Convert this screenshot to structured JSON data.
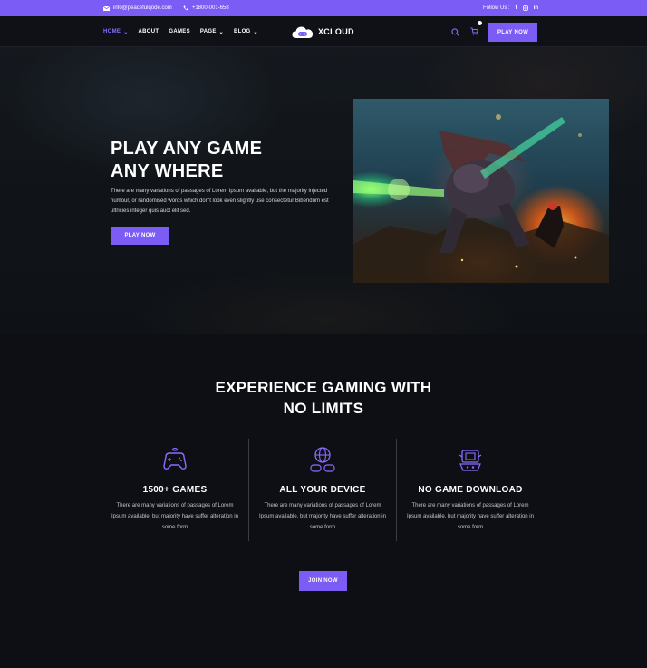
{
  "topbar": {
    "email": "info@peacefulqode.com",
    "phone": "+1800-001-658",
    "follow_label": "Follow Us :",
    "social": [
      "f",
      "ig",
      "in"
    ]
  },
  "nav": {
    "menu": [
      {
        "label": "HOME",
        "has_caret": true,
        "active": true
      },
      {
        "label": "ABOUT",
        "has_caret": false,
        "active": false
      },
      {
        "label": "GAMES",
        "has_caret": false,
        "active": false
      },
      {
        "label": "PAGE",
        "has_caret": true,
        "active": false
      },
      {
        "label": "BLOG",
        "has_caret": true,
        "active": false
      }
    ],
    "logo_text": "XCLOUD",
    "cta_label": "PLAY NOW"
  },
  "hero": {
    "title_line1": "PLAY ANY GAME",
    "title_line2": "ANY WHERE",
    "description": "There are many variations of passages of Lorem Ipsum available, but the majority injected humour, or randomised words which don't look even slightly use consectetur Bibendum est ultricies integer quis auct elit sed.",
    "button_label": "PLAY NOW"
  },
  "features": {
    "heading_line1": "EXPERIENCE GAMING WITH",
    "heading_line2": "NO LIMITS",
    "items": [
      {
        "title": "1500+ GAMES",
        "text": "There are many variations of passages of Lorem Ipsum available, but majority have suffer alteration in some form",
        "icon": "gamepad-icon"
      },
      {
        "title": "ALL YOUR DEVICE",
        "text": "There are many variations of passages of Lorem Ipsum available, but majority have suffer alteration in some form",
        "icon": "globe-controllers-icon"
      },
      {
        "title": "NO GAME DOWNLOAD",
        "text": "There are many variations of passages of Lorem Ipsum available, but majority have suffer alteration in some form",
        "icon": "arcade-cabinet-icon"
      }
    ],
    "button_label": "JOIN NOW"
  },
  "colors": {
    "accent": "#7b5cf5",
    "background": "#0d0f14",
    "nav": "#0f1117"
  }
}
